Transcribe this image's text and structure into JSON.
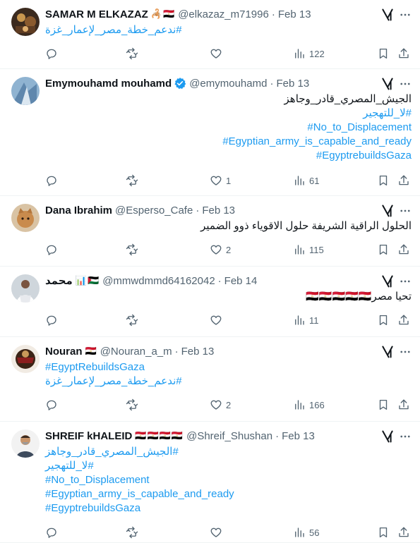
{
  "tweets": [
    {
      "name": "SAMAR M ELKAZAZ",
      "flags": "🦂🇪🇬",
      "handle": "@elkazaz_m71996",
      "date": "Feb 13",
      "verified": false,
      "lines": [
        {
          "text": "#ندعم_خطة_مصر_لإعمار_غزة",
          "kind": "tag",
          "dir": "rtl-left"
        }
      ],
      "stats": {
        "replies": "",
        "reposts": "",
        "likes": "",
        "views": "122"
      }
    },
    {
      "name": "Emymouhamd mouhamd",
      "flags": "",
      "handle": "@emymouhamd",
      "date": "Feb 13",
      "verified": true,
      "lines": [
        {
          "text": "الجيش_المصري_قادر_وجاهز",
          "kind": "text",
          "dir": "rtl"
        },
        {
          "text": "#لا_للتهجير",
          "kind": "tag",
          "dir": "rtl"
        },
        {
          "text": "#No_to_Displacement",
          "kind": "tag",
          "dir": "ltr-right"
        },
        {
          "text": "#Egyptian_army_is_capable_and_ready",
          "kind": "tag",
          "dir": "ltr-right"
        },
        {
          "text": "#EgyptrebuildsGaza",
          "kind": "tag",
          "dir": "ltr-right"
        }
      ],
      "stats": {
        "replies": "",
        "reposts": "",
        "likes": "1",
        "views": "61"
      }
    },
    {
      "name": "Dana Ibrahim",
      "flags": "",
      "handle": "@Esperso_Cafe",
      "date": "Feb 13",
      "verified": false,
      "lines": [
        {
          "text": "الحلول الراقية الشريفة حلول الاقوياء ذوو الضمير",
          "kind": "text",
          "dir": "rtl"
        }
      ],
      "stats": {
        "replies": "",
        "reposts": "",
        "likes": "2",
        "views": "115"
      }
    },
    {
      "name": "محمد",
      "flags": "📊🇵🇸",
      "handle": "@mmwdmmd64162042",
      "date": "Feb 14",
      "verified": false,
      "lines": [
        {
          "text": "تحيا مصر🇪🇬🇪🇬🇪🇬🇪🇬🇪🇬",
          "kind": "text",
          "dir": "rtl"
        }
      ],
      "stats": {
        "replies": "",
        "reposts": "",
        "likes": "",
        "views": "11"
      }
    },
    {
      "name": "Nouran",
      "flags": "🇪🇬",
      "handle": "@Nouran_a_m",
      "date": "Feb 13",
      "verified": false,
      "lines": [
        {
          "text": "#EgyptRebuildsGaza",
          "kind": "tag",
          "dir": "ltr-left"
        },
        {
          "text": "#ندعم_خطة_مصر_لإعمار_غزة",
          "kind": "tag",
          "dir": "rtl-left"
        }
      ],
      "stats": {
        "replies": "",
        "reposts": "",
        "likes": "2",
        "views": "166"
      }
    },
    {
      "name": "SHREIF kHALEID",
      "flags": "🇪🇬🇪🇬🇪🇬🇪🇬",
      "handle": "@Shreif_Shushan",
      "date": "Feb 13",
      "verified": false,
      "lines": [
        {
          "text": "#الجيش_المصري_قادر_وجاهز",
          "kind": "tag",
          "dir": "rtl-left"
        },
        {
          "text": "#لا_للتهجير",
          "kind": "tag",
          "dir": "rtl-left"
        },
        {
          "text": "#No_to_Displacement",
          "kind": "tag",
          "dir": "ltr-left"
        },
        {
          "text": "#Egyptian_army_is_capable_and_ready",
          "kind": "tag",
          "dir": "ltr-left"
        },
        {
          "text": "#EgyptrebuildsGaza",
          "kind": "tag",
          "dir": "ltr-left"
        }
      ],
      "stats": {
        "replies": "",
        "reposts": "",
        "likes": "",
        "views": "56"
      }
    }
  ],
  "icons": {
    "reply": "reply-icon",
    "repost": "repost-icon",
    "like": "heart-icon",
    "views": "views-icon",
    "bookmark": "bookmark-icon",
    "share": "share-icon",
    "grok": "grok-icon",
    "more": "more-icon",
    "verified": "verified-badge-icon"
  },
  "colors": {
    "link": "#1d9bf0",
    "muted": "#536471",
    "text": "#0f1419",
    "verified": "#1d9bf0",
    "divider": "#eff3f4"
  }
}
